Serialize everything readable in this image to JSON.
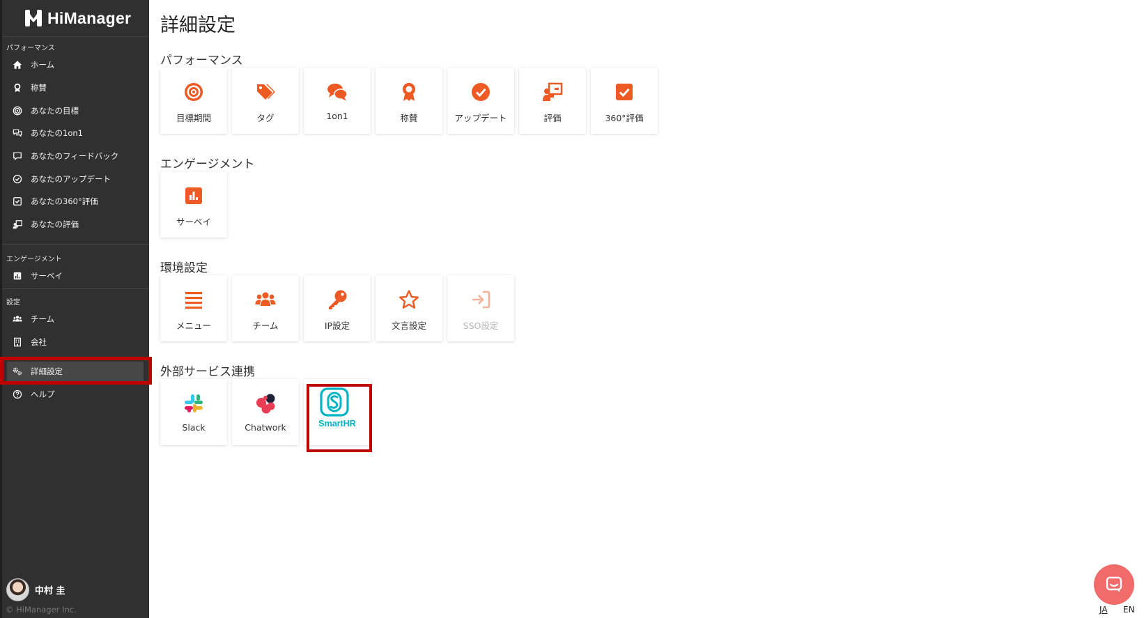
{
  "brand": {
    "name": "HiManager"
  },
  "colors": {
    "accent": "#ee5a24",
    "sidebar_bg": "#303030",
    "smarthr": "#00b4c4",
    "highlight": "#c00000"
  },
  "sidebar": {
    "sections": [
      {
        "label": "パフォーマンス",
        "items": [
          {
            "label": "ホーム",
            "icon": "home-icon"
          },
          {
            "label": "称賛",
            "icon": "medal-icon"
          },
          {
            "label": "あなたの目標",
            "icon": "target-icon"
          },
          {
            "label": "あなたの1on1",
            "icon": "chat-icon"
          },
          {
            "label": "あなたのフィードバック",
            "icon": "comment-icon"
          },
          {
            "label": "あなたのアップデート",
            "icon": "check-circle-icon"
          },
          {
            "label": "あなたの360°評価",
            "icon": "check-square-icon"
          },
          {
            "label": "あなたの評価",
            "icon": "presentation-icon"
          }
        ]
      },
      {
        "label": "エンゲージメント",
        "items": [
          {
            "label": "サーベイ",
            "icon": "poll-icon"
          }
        ]
      },
      {
        "label": "設定",
        "items": [
          {
            "label": "チーム",
            "icon": "users-icon"
          },
          {
            "label": "会社",
            "icon": "building-icon"
          },
          {
            "label": "詳細設定",
            "icon": "cogs-icon",
            "active": true
          },
          {
            "label": "ヘルプ",
            "icon": "question-icon"
          }
        ]
      }
    ],
    "user": {
      "name": "中村 圭"
    },
    "copyright": "© HiManager Inc."
  },
  "main": {
    "title": "詳細設定",
    "groups": [
      {
        "title": "パフォーマンス",
        "cards": [
          {
            "label": "目標期間",
            "icon": "target-icon"
          },
          {
            "label": "タグ",
            "icon": "tags-icon"
          },
          {
            "label": "1on1",
            "icon": "comments-icon"
          },
          {
            "label": "称賛",
            "icon": "award-icon"
          },
          {
            "label": "アップデート",
            "icon": "check-circle-icon"
          },
          {
            "label": "評価",
            "icon": "presentation-icon"
          },
          {
            "label": "360°評価",
            "icon": "check-square-icon"
          }
        ]
      },
      {
        "title": "エンゲージメント",
        "cards": [
          {
            "label": "サーベイ",
            "icon": "poll-icon"
          }
        ]
      },
      {
        "title": "環境設定",
        "cards": [
          {
            "label": "メニュー",
            "icon": "menu-icon"
          },
          {
            "label": "チーム",
            "icon": "users-icon"
          },
          {
            "label": "IP設定",
            "icon": "key-icon"
          },
          {
            "label": "文言設定",
            "icon": "star-icon"
          },
          {
            "label": "SSO設定",
            "icon": "sign-in-icon",
            "disabled": true
          }
        ]
      },
      {
        "title": "外部サービス連携",
        "cards": [
          {
            "label": "Slack",
            "icon": "slack-logo"
          },
          {
            "label": "Chatwork",
            "icon": "chatwork-logo"
          },
          {
            "label": "SmartHR",
            "icon": "smarthr-logo",
            "highlighted": true
          }
        ]
      }
    ]
  },
  "footer": {
    "lang_ja": "JA",
    "lang_en": "EN"
  }
}
